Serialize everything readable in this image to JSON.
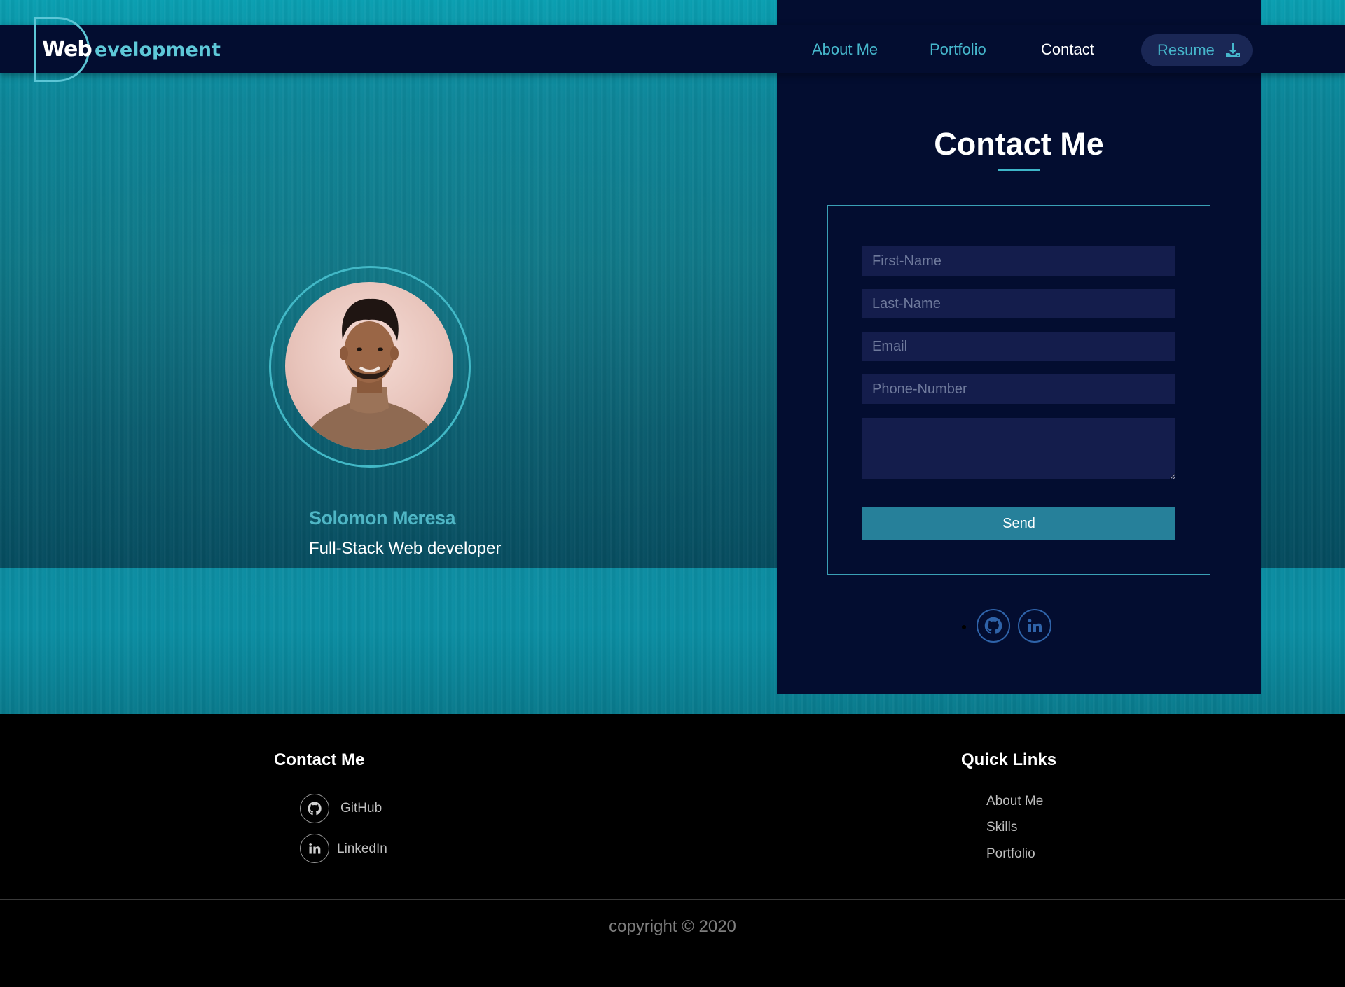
{
  "logo": {
    "bold": "Web",
    "rest": "evelopment"
  },
  "nav": {
    "items": [
      {
        "label": "About Me"
      },
      {
        "label": "Portfolio"
      },
      {
        "label": "Contact"
      }
    ],
    "resume_label": "Resume"
  },
  "profile": {
    "name": "Solomon Meresa",
    "role": "Full-Stack Web developer"
  },
  "contact": {
    "title": "Contact Me",
    "fields": {
      "first_name": "First-Name",
      "last_name": "Last-Name",
      "email": "Email",
      "phone": "Phone-Number",
      "message": ""
    },
    "send_label": "Send",
    "social_icons": [
      "github-icon",
      "linkedin-icon"
    ]
  },
  "footer": {
    "contact_heading": "Contact Me",
    "social": [
      {
        "label": "GitHub",
        "icon": "github-icon"
      },
      {
        "label": "LinkedIn",
        "icon": "linkedin-icon"
      }
    ],
    "quick_links_heading": "Quick Links",
    "quick_links": [
      "About Me",
      "Skills",
      "Portfolio"
    ],
    "copyright": "copyright © 2020"
  },
  "colors": {
    "navy": "#030d30",
    "accent": "#46b7cc",
    "button": "#26809a",
    "input_bg": "#141d4c"
  }
}
